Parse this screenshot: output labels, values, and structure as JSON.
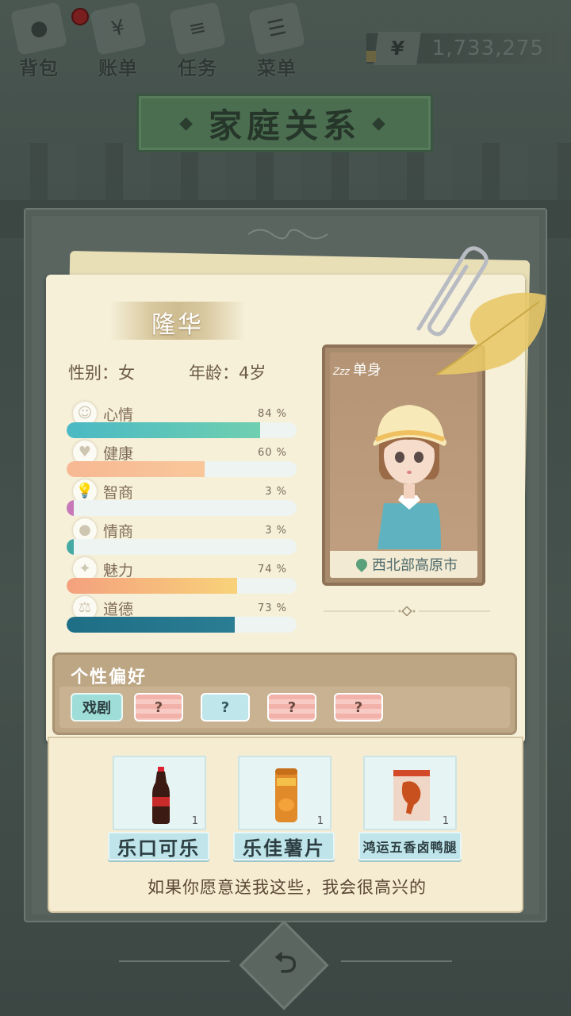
{
  "topbar": {
    "items": [
      {
        "label": "背包",
        "icon": "bag-icon"
      },
      {
        "label": "账单",
        "icon": "bill-icon"
      },
      {
        "label": "任务",
        "icon": "task-icon"
      },
      {
        "label": "菜单",
        "icon": "menu-icon"
      }
    ],
    "money_symbol": "¥",
    "money": "1,733,275"
  },
  "banner": {
    "title": "家庭关系",
    "left_deco": "◆",
    "right_deco": "◆"
  },
  "profile": {
    "name": "隆华",
    "gender": "性别：女",
    "age": "年龄：4岁",
    "status": "单身",
    "status_icon": "Zzz",
    "location": "西北部高原市"
  },
  "stats": [
    {
      "label": "心情",
      "pct_text": "84 %",
      "value": 0.84,
      "icon": "smile-icon",
      "colors": [
        "#4ab9c4",
        "#6fcfb0"
      ]
    },
    {
      "label": "健康",
      "pct_text": "60 %",
      "value": 0.6,
      "icon": "heart-icon",
      "colors": [
        "#f7b893",
        "#f9c79a"
      ]
    },
    {
      "label": "智商",
      "pct_text": "3 %",
      "value": 0.03,
      "icon": "bulb-icon",
      "colors": [
        "#c778b8",
        "#c778b8"
      ]
    },
    {
      "label": "情商",
      "pct_text": "3 %",
      "value": 0.03,
      "icon": "apple-icon",
      "colors": [
        "#45a9a4",
        "#45a9a4"
      ]
    },
    {
      "label": "魅力",
      "pct_text": "74 %",
      "value": 0.74,
      "icon": "sparkle-icon",
      "colors": [
        "#f4a17e",
        "#f8d27a"
      ]
    },
    {
      "label": "道德",
      "pct_text": "73 %",
      "value": 0.73,
      "icon": "scale-icon",
      "colors": [
        "#1e6e86",
        "#2b7d94"
      ]
    }
  ],
  "personality": {
    "title": "个性偏好",
    "tags": [
      {
        "label": "戏剧",
        "kind": "drama"
      },
      {
        "label": "?",
        "kind": "pink"
      },
      {
        "label": "?",
        "kind": "blue"
      },
      {
        "label": "?",
        "kind": "pink"
      },
      {
        "label": "?",
        "kind": "pink"
      }
    ]
  },
  "gifts": {
    "items": [
      {
        "name": "乐口可乐",
        "count": "1",
        "icon": "cola-bottle-icon"
      },
      {
        "name": "乐佳薯片",
        "count": "1",
        "icon": "chips-can-icon"
      },
      {
        "name": "鸿运五香卤鸭腿",
        "count": "1",
        "icon": "duck-leg-pack-icon"
      }
    ],
    "message": "如果你愿意送我这些，我会很高兴的"
  },
  "nav": {
    "back_icon": "back-arrow-icon"
  }
}
